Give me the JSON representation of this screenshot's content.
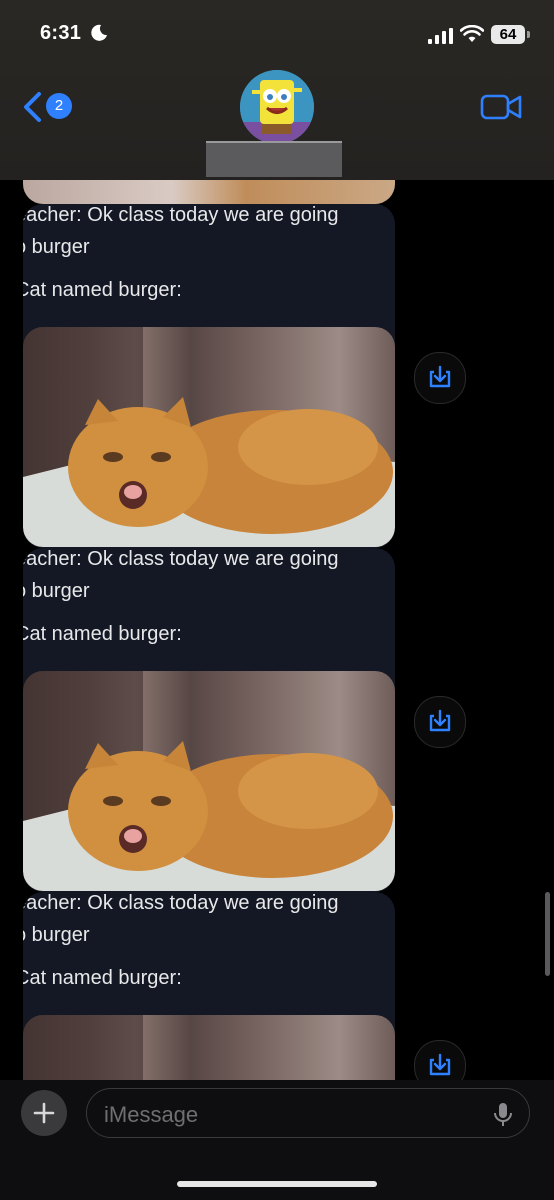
{
  "status_bar": {
    "time": "6:31",
    "battery": "64"
  },
  "nav": {
    "back_badge": "2"
  },
  "messages": [
    {
      "line1": "eacher: Ok class today we are going",
      "line2": "o burger",
      "line3": "Cat named burger:"
    },
    {
      "line1": "eacher: Ok class today we are going",
      "line2": "o burger",
      "line3": "Cat named burger:"
    },
    {
      "line1": "eacher: Ok class today we are going",
      "line2": "o burger",
      "line3": "Cat named burger:"
    }
  ],
  "composer": {
    "placeholder": "iMessage"
  },
  "icons": {
    "moon": "moon-icon",
    "signal": "signal-icon",
    "wifi": "wifi-icon",
    "back": "chevron-left-icon",
    "video": "video-camera-icon",
    "save": "download-icon",
    "plus": "plus-icon",
    "mic": "microphone-icon"
  },
  "colors": {
    "accent": "#2f80ff",
    "bubble": "#141824",
    "background": "#000000"
  }
}
